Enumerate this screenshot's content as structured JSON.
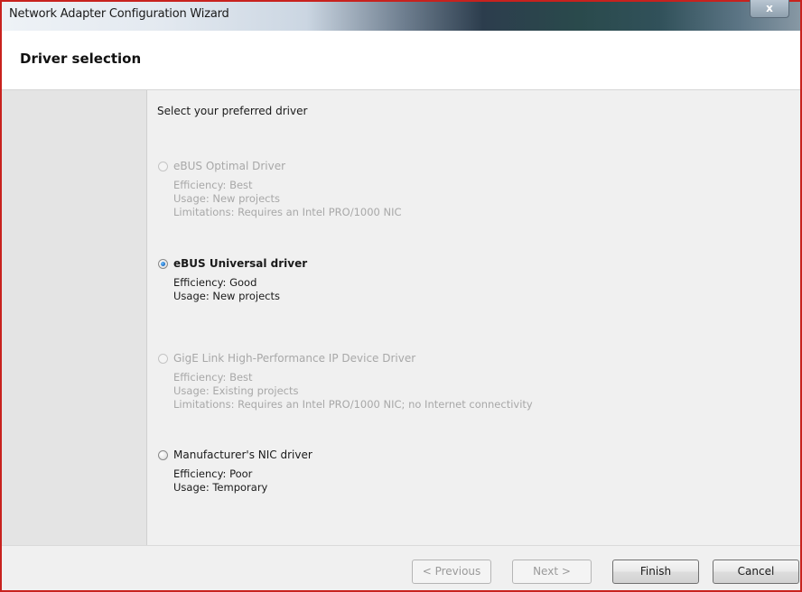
{
  "window": {
    "title": "Network Adapter Configuration Wizard",
    "close_label": "x"
  },
  "header": {
    "title": "Driver selection"
  },
  "content": {
    "instruction": "Select your preferred driver",
    "options": [
      {
        "label": "eBUS Optimal Driver",
        "selected": false,
        "enabled": false,
        "details": [
          "Efficiency: Best",
          "Usage: New projects",
          "Limitations: Requires an Intel PRO/1000 NIC"
        ]
      },
      {
        "label": "eBUS Universal driver",
        "selected": true,
        "enabled": true,
        "details": [
          "Efficiency: Good",
          "Usage: New projects"
        ]
      },
      {
        "label": "GigE Link High-Performance IP Device Driver",
        "selected": false,
        "enabled": false,
        "details": [
          "Efficiency: Best",
          "Usage: Existing projects",
          "Limitations: Requires an Intel PRO/1000 NIC; no Internet connectivity"
        ]
      },
      {
        "label": "Manufacturer's NIC driver",
        "selected": false,
        "enabled": true,
        "details": [
          "Efficiency: Poor",
          "Usage: Temporary"
        ]
      }
    ]
  },
  "footer": {
    "previous_label": "< Previous",
    "next_label": "Next >",
    "finish_label": "Finish",
    "cancel_label": "Cancel"
  },
  "colors": {
    "frame_accent": "#c8221e",
    "disabled_text": "#a8a8a8",
    "panel_bg": "#f0f0f0",
    "sidebar_bg": "#e4e4e4"
  }
}
